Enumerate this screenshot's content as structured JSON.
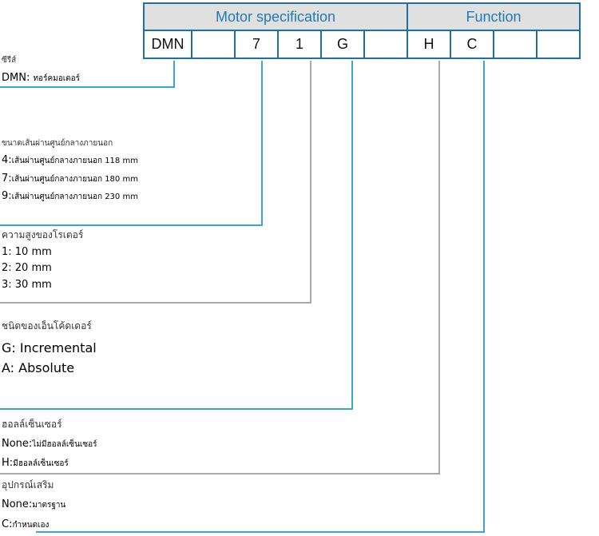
{
  "table": {
    "groups": [
      {
        "label": "Motor specification"
      },
      {
        "label": "Function"
      }
    ],
    "codes": [
      "DMN",
      "",
      "7",
      "1",
      "G",
      "",
      "H",
      "C",
      "",
      ""
    ]
  },
  "colors": {
    "border": "#1f6fa0",
    "header_text": "#1f7bb3",
    "header_bg": "#e0e0e0",
    "connector_blue": "#3ba3d8",
    "connector_gray": "#aaaaaa"
  },
  "sections": {
    "series": {
      "title": "ซีรีส์",
      "items": [
        {
          "code": "DMN: ",
          "desc": "ทอร์คมอเตอร์"
        }
      ]
    },
    "diameter": {
      "title": "ขนาดเส้นผ่านศูนย์กลางภายนอก",
      "items": [
        {
          "code": "4:",
          "desc": "เส้นผ่านศูนย์กลางภายนอก",
          "value": " 118 mm"
        },
        {
          "code": "7:",
          "desc": "เส้นผ่านศูนย์กลางภายนอก",
          "value": " 180 mm"
        },
        {
          "code": "9:",
          "desc": "เส้นผ่านศูนย์กลางภายนอก",
          "value": " 230 mm"
        }
      ]
    },
    "height": {
      "title": "ความสูงของโรเตอร์",
      "items": [
        {
          "code": "1: 10 mm"
        },
        {
          "code": "2: 20 mm"
        },
        {
          "code": "3: 30 mm"
        }
      ]
    },
    "encoder": {
      "title": "ชนิดของเอ็นโค้ดเดอร์",
      "items": [
        {
          "code": "G: Incremental"
        },
        {
          "code": "A: Absolute"
        }
      ]
    },
    "hall": {
      "title": "ฮอลล์เซ็นเซอร์",
      "items": [
        {
          "code": "None:",
          "desc": "ไม่มีฮอลล์เซ็นเซอร์"
        },
        {
          "code": "H:",
          "desc": "มีฮอลล์เซ็นเซอร์"
        }
      ]
    },
    "accessory": {
      "title": "อุปกรณ์เสริม",
      "items": [
        {
          "code": "None:",
          "desc": "มาตรฐาน"
        },
        {
          "code": "C:",
          "desc": "กำหนดเอง"
        }
      ]
    }
  }
}
